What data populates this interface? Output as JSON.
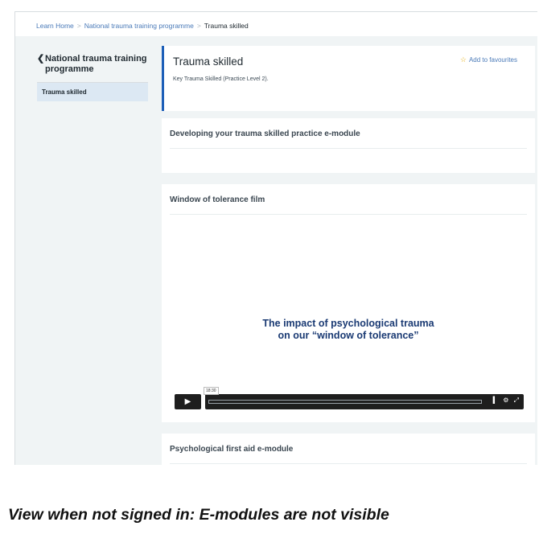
{
  "breadcrumb": {
    "items": [
      {
        "label": "Learn Home"
      },
      {
        "label": "National trauma training programme"
      },
      {
        "label": "Trauma skilled"
      }
    ],
    "separator": ">"
  },
  "sidebar": {
    "back_label": "National trauma training programme",
    "items": [
      {
        "label": "Trauma skilled",
        "active": true
      }
    ]
  },
  "header": {
    "title": "Trauma skilled",
    "subtitle": "Key Trauma Skilled (Practice Level 2).",
    "favourite_label": "Add to favourites"
  },
  "modules": [
    {
      "title": "Developing your trauma skilled practice e-module"
    },
    {
      "title": "Window of tolerance film"
    },
    {
      "title": "Psychological first aid e-module"
    }
  ],
  "video": {
    "caption_line1": "The impact of psychological trauma",
    "caption_line2": "on our “window of tolerance”",
    "time": "18:30"
  },
  "note": "View when not signed in: E-modules are not visible",
  "colors": {
    "accent": "#1d5fb8",
    "page_bg": "#f0f4f5",
    "sidebar_active": "#dce8f3",
    "star": "#e6b422",
    "video_caption": "#1a3a73"
  }
}
